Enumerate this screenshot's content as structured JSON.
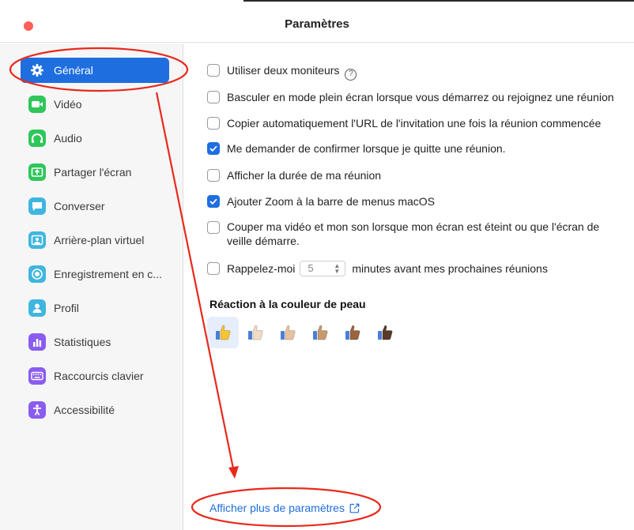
{
  "window": {
    "title": "Paramètres"
  },
  "sidebar": {
    "items": [
      {
        "label": "Général",
        "icon": "gear-icon",
        "color": "#1e6ee0",
        "active": true
      },
      {
        "label": "Vidéo",
        "icon": "video-camera-icon",
        "color": "#2fc65a"
      },
      {
        "label": "Audio",
        "icon": "headphones-icon",
        "color": "#2fc65a"
      },
      {
        "label": "Partager l'écran",
        "icon": "share-screen-icon",
        "color": "#2fc65a"
      },
      {
        "label": "Converser",
        "icon": "chat-bubble-icon",
        "color": "#3fb6e0"
      },
      {
        "label": "Arrière-plan virtuel",
        "icon": "virtual-background-icon",
        "color": "#3fb6e0"
      },
      {
        "label": "Enregistrement en c...",
        "icon": "record-icon",
        "color": "#3fb6e0"
      },
      {
        "label": "Profil",
        "icon": "profile-icon",
        "color": "#3fb6e0"
      },
      {
        "label": "Statistiques",
        "icon": "bar-chart-icon",
        "color": "#8a5cf0"
      },
      {
        "label": "Raccourcis clavier",
        "icon": "keyboard-icon",
        "color": "#8a5cf0"
      },
      {
        "label": "Accessibilité",
        "icon": "accessibility-icon",
        "color": "#8a5cf0"
      }
    ]
  },
  "general": {
    "options": [
      {
        "label": "Utiliser deux moniteurs",
        "checked": false,
        "help": "?"
      },
      {
        "label": "Basculer en mode plein écran lorsque vous démarrez ou rejoignez une réunion",
        "checked": false
      },
      {
        "label": "Copier automatiquement l'URL de l'invitation une fois la réunion commencée",
        "checked": false
      },
      {
        "label": "Me demander de confirmer lorsque je quitte une réunion.",
        "checked": true
      },
      {
        "label": "Afficher la durée de ma réunion",
        "checked": false
      },
      {
        "label": "Ajouter Zoom à la barre de menus macOS",
        "checked": true
      },
      {
        "label": "Couper ma vidéo et mon son lorsque mon écran est éteint ou que l'écran de veille démarre.",
        "checked": false
      }
    ],
    "reminder": {
      "checked": false,
      "prefix": "Rappelez-moi",
      "value": "5",
      "suffix": "minutes avant mes prochaines réunions"
    },
    "skin_tone": {
      "title": "Réaction à la couleur de peau",
      "selected_index": 0,
      "tones": [
        "#f7c531",
        "#f3dcc4",
        "#e7c29f",
        "#c99a6e",
        "#9a643d",
        "#5a3b28"
      ]
    },
    "more_link": "Afficher plus de paramètres"
  },
  "colors": {
    "accent": "#1e6ee0",
    "annotation": "#e8291c"
  }
}
